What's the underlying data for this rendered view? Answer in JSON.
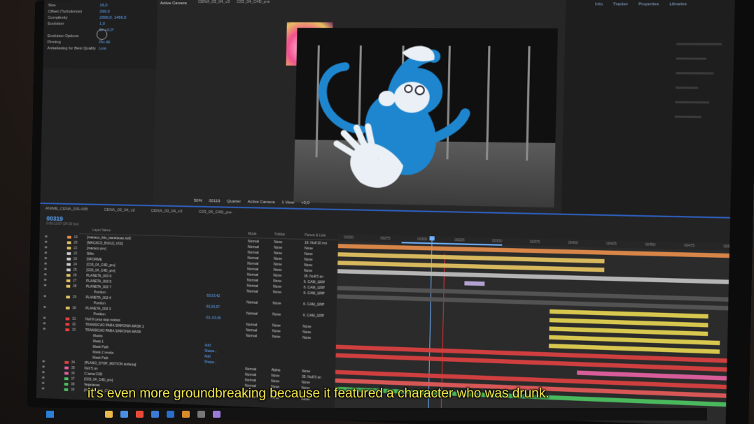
{
  "effect_controls": {
    "rows": [
      {
        "label": "Size",
        "value": "16,0"
      },
      {
        "label": "Offset (Turbulence)",
        "value": "299,0"
      },
      {
        "label": "Complexity",
        "value": "2300,0, 1466,5"
      },
      {
        "label": "Evolution",
        "value": "1,0"
      },
      {
        "label": "",
        "value": "0x +0,0°"
      },
      {
        "label": "Evolution Options",
        "value": ""
      },
      {
        "label": "Pinning",
        "value": "Pin All"
      },
      {
        "label": "Antialiasing for Best Quality",
        "value": "Low"
      }
    ]
  },
  "viewer": {
    "panel_label": "Active Camera",
    "comp_tabs": [
      "CENA_03_04_v3",
      "C03_04_C4D_pre"
    ],
    "toolbar": [
      "50%",
      "00119",
      "Quarter",
      "Active Camera",
      "1 View",
      "+0,0"
    ]
  },
  "right_panel": {
    "tabs": [
      "Info",
      "Tracker",
      "Properties",
      "Libraries"
    ]
  },
  "timeline": {
    "tabs": [
      "ANIME_CENA_001-005",
      "CENA_03_04_v2",
      "CENA_03_04_v3",
      "C03_04_C4D_pre"
    ],
    "timecode": "00319",
    "timecode_sub": "0:00:13:07 (24.00 fps)",
    "columns": {
      "name": "Layer Name",
      "mode": "Mode",
      "trkmat": "TrkMat",
      "parent": "Parent & Link"
    },
    "ruler": [
      "00250",
      "00275",
      "00300",
      "00325",
      "00350",
      "00375",
      "00400",
      "00425",
      "00450",
      "00475",
      "00500"
    ],
    "layers": [
      {
        "num": "19",
        "name": "[macaco_bits_translacao.swf]",
        "mode": "Normal",
        "trk": "None",
        "parent": "18. Null 10 mo",
        "color": "#e08a4a",
        "type": "layer"
      },
      {
        "num": "20",
        "name": "[MACACO_BUILD_V02]",
        "mode": "Normal",
        "trk": "None",
        "parent": "None",
        "color": "#e0c060",
        "type": "layer"
      },
      {
        "num": "21",
        "name": "[macaco pre]",
        "mode": "Normal",
        "trk": "None",
        "parent": "None",
        "color": "#e0c060",
        "type": "layer"
      },
      {
        "num": "22",
        "name": "Silhs",
        "mode": "Normal",
        "trk": "None",
        "parent": "None",
        "color": "#c9c9c9",
        "type": "layer"
      },
      {
        "num": "23",
        "name": "DIFORME",
        "mode": "Normal",
        "trk": "None",
        "parent": "None",
        "color": "#c9c9c9",
        "type": "layer"
      },
      {
        "num": "24",
        "name": "[C03_04_C4D_pre]",
        "mode": "Normal",
        "trk": "None",
        "parent": "None",
        "color": "#c9c9c9",
        "type": "layer"
      },
      {
        "num": "25",
        "name": "[C03_04_C4D_pre]",
        "mode": "Normal",
        "trk": "None",
        "parent": "35. Null 5 on",
        "color": "#c9c9c9",
        "type": "layer"
      },
      {
        "num": "26",
        "name": "PLANETA_003 6",
        "mode": "Normal",
        "trk": "None",
        "parent": "6. CAM_GRP",
        "color": "#e0c060",
        "type": "layer"
      },
      {
        "num": "27",
        "name": "PLANETA_003 5",
        "mode": "Normal",
        "trk": "None",
        "parent": "6. CAM_GRP",
        "color": "#e0c060",
        "type": "layer"
      },
      {
        "num": "28",
        "name": "PLANETA_003 7",
        "mode": "Normal",
        "trk": "None",
        "parent": "6. CAM_GRP",
        "color": "#e0c060",
        "type": "layer"
      },
      {
        "num": "",
        "name": "Position",
        "value": "-53,03,42",
        "type": "prop"
      },
      {
        "num": "29",
        "name": "PLANETA_003 4",
        "mode": "Normal",
        "trk": "None",
        "parent": "6. CAM_GRP",
        "color": "#e0c060",
        "type": "layer"
      },
      {
        "num": "",
        "name": "Position",
        "value": "-52,00,57",
        "type": "prop"
      },
      {
        "num": "30",
        "name": "PLANETA_003 3",
        "mode": "Normal",
        "trk": "None",
        "parent": "6. CAM_GRP",
        "color": "#e0c060",
        "type": "layer"
      },
      {
        "num": "",
        "name": "Position",
        "value": "-53,-03,49",
        "type": "prop"
      },
      {
        "num": "31",
        "name": "Null 9 cena stop motion",
        "mode": "Normal",
        "trk": "None",
        "parent": "None",
        "color": "#e04040",
        "type": "layer"
      },
      {
        "num": "32",
        "name": "TRANSICAO PARA SINFONIA MASK 2",
        "mode": "Normal",
        "trk": "None",
        "parent": "None",
        "color": "#e04040",
        "type": "layer"
      },
      {
        "num": "33",
        "name": "TRANSICAO PARA SINFONIA MASK",
        "mode": "Normal",
        "trk": "None",
        "parent": "None",
        "color": "#e04040",
        "type": "layer"
      },
      {
        "num": "",
        "name": "Masks",
        "value": "",
        "type": "prop"
      },
      {
        "num": "",
        "name": "Mask 1",
        "value": "Add",
        "type": "prop"
      },
      {
        "num": "",
        "name": "Mask Path",
        "value": "Shape...",
        "type": "prop"
      },
      {
        "num": "",
        "name": "Mask 2 revela",
        "value": "Add",
        "type": "prop"
      },
      {
        "num": "",
        "name": "Mask Path",
        "value": "Shape...",
        "type": "prop"
      },
      {
        "num": "34",
        "name": "[PLANO_STOP_MOTION sinfonia]",
        "mode": "Normal",
        "trk": "Alpha",
        "parent": "None",
        "color": "#e04040",
        "type": "layer"
      },
      {
        "num": "35",
        "name": "Null 5 on",
        "mode": "Normal",
        "trk": "None",
        "parent": "35. Null 5 on",
        "color": "#e060a0",
        "type": "layer"
      },
      {
        "num": "36",
        "name": "C lama C4D",
        "mode": "Normal",
        "trk": "None",
        "parent": "None",
        "color": "#e060a0",
        "type": "layer"
      },
      {
        "num": "37",
        "name": "[C03_04_C4D_pre]",
        "mode": "Normal",
        "trk": "None",
        "parent": "None",
        "color": "#4cc060",
        "type": "layer"
      },
      {
        "num": "38",
        "name": "Vegetacao",
        "mode": "Normal",
        "trk": "None",
        "parent": "None",
        "color": "#4cc060",
        "type": "layer"
      },
      {
        "num": "39",
        "name": "[ANIME_100_C03_04_V002.c4d]",
        "mode": "Normal",
        "trk": "None",
        "parent": "None",
        "color": "#4cc060",
        "type": "layer"
      }
    ],
    "tracks": [
      {
        "start": 0.0,
        "end": 1.0,
        "color": "#e08a4a"
      },
      {
        "start": 0.0,
        "end": 0.66,
        "color": "#e0c060"
      },
      {
        "start": 0.0,
        "end": 0.66,
        "color": "#e0c060"
      },
      {
        "start": 0.0,
        "end": 1.0,
        "color": "#bdbdbd"
      },
      {
        "start": 0.32,
        "end": 0.37,
        "color": "#b9a8d8"
      },
      {
        "start": 0.0,
        "end": 1.0,
        "color": "#555555"
      },
      {
        "start": 0.0,
        "end": 1.0,
        "color": "#555555"
      },
      {
        "start": 0.53,
        "end": 0.91,
        "color": "#e0d050"
      },
      {
        "start": 0.53,
        "end": 0.91,
        "color": "#e0d050"
      },
      {
        "start": 0.53,
        "end": 0.91,
        "color": "#e0d050"
      },
      {
        "start": 0.53,
        "end": 0.94,
        "color": "#e0d050"
      },
      {
        "start": 0.53,
        "end": 0.94,
        "color": "#e0d050"
      },
      {
        "start": 0.0,
        "end": 1.0,
        "color": "#d84040"
      },
      {
        "start": 0.0,
        "end": 1.0,
        "color": "#d84040"
      },
      {
        "start": 0.6,
        "end": 1.0,
        "color": "#e060a0"
      },
      {
        "start": 0.0,
        "end": 1.0,
        "color": "#d84040"
      },
      {
        "start": 0.0,
        "end": 1.0,
        "color": "#e05a5a"
      },
      {
        "start": 0.0,
        "end": 1.0,
        "color": "#4cc060"
      }
    ]
  },
  "subtitle": "it's even more groundbreaking because it featured a character who was drunk.",
  "taskbar": {
    "icons": [
      {
        "name": "file-explorer-icon",
        "color": "#e8b84a"
      },
      {
        "name": "browser-icon",
        "color": "#4a90e2"
      },
      {
        "name": "chrome-icon",
        "color": "#e84a3a"
      },
      {
        "name": "mail-icon",
        "color": "#3a7bd5"
      },
      {
        "name": "photoshop-icon",
        "color": "#2a6fc9"
      },
      {
        "name": "illustrator-icon",
        "color": "#d98a2a"
      },
      {
        "name": "store-icon",
        "color": "#777777"
      },
      {
        "name": "after-effects-icon",
        "color": "#9a7ad8"
      }
    ]
  }
}
